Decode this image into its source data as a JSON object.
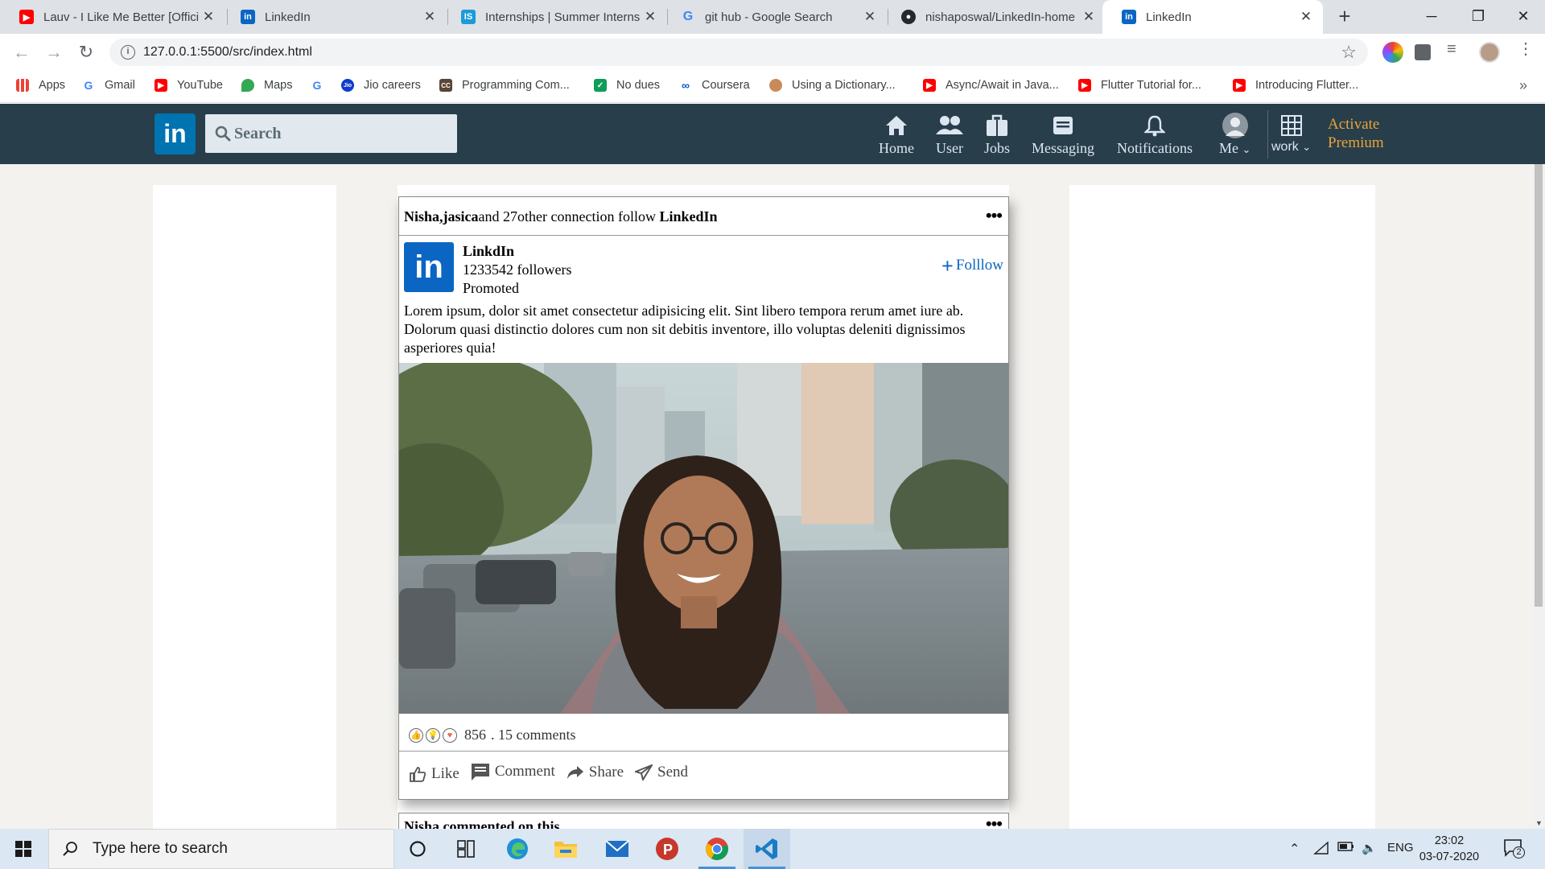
{
  "browser": {
    "tabs": [
      {
        "title": "Lauv - I Like Me Better [Offici",
        "favicon": "youtube-icon",
        "active": false
      },
      {
        "title": "LinkedIn",
        "favicon": "linkedin-icon",
        "active": false
      },
      {
        "title": "Internships | Summer Interns",
        "favicon": "internshala-icon",
        "active": false
      },
      {
        "title": "git hub - Google Search",
        "favicon": "google-icon",
        "active": false
      },
      {
        "title": "nishaposwal/LinkedIn-home",
        "favicon": "github-icon",
        "active": false
      },
      {
        "title": "LinkedIn",
        "favicon": "linkedin-icon",
        "active": true
      }
    ],
    "url": "127.0.0.1:5500/src/index.html",
    "bookmarks": [
      {
        "label": "Apps",
        "icon": "apps-grid-icon"
      },
      {
        "label": "Gmail",
        "icon": "google-icon"
      },
      {
        "label": "YouTube",
        "icon": "youtube-icon"
      },
      {
        "label": "Maps",
        "icon": "maps-pin-icon"
      },
      {
        "label": "",
        "icon": "google-icon"
      },
      {
        "label": "Jio careers",
        "icon": "jio-icon"
      },
      {
        "label": "Programming Com...",
        "icon": "cc-icon"
      },
      {
        "label": "No dues",
        "icon": "sheet-icon"
      },
      {
        "label": "Coursera",
        "icon": "coursera-icon"
      },
      {
        "label": "Using a Dictionary...",
        "icon": "avatar-icon"
      },
      {
        "label": "Async/Await in Java...",
        "icon": "youtube-icon"
      },
      {
        "label": "Flutter Tutorial for...",
        "icon": "youtube-icon"
      },
      {
        "label": "Introducing Flutter...",
        "icon": "youtube-icon"
      }
    ]
  },
  "header": {
    "logo": "in",
    "search_placeholder": "Search",
    "nav": [
      {
        "label": "Home",
        "icon": "home-icon"
      },
      {
        "label": "User",
        "icon": "users-icon"
      },
      {
        "label": "Jobs",
        "icon": "briefcase-icon"
      },
      {
        "label": "Messaging",
        "icon": "messaging-icon"
      },
      {
        "label": "Notifications",
        "icon": "bell-icon"
      },
      {
        "label": "Me",
        "icon": "avatar-icon"
      }
    ],
    "work_label": "work",
    "premium_line1": "Activate",
    "premium_line2": "Premium"
  },
  "post": {
    "connection_names": "Nisha,jasica",
    "connection_text": "and 27other connection follow ",
    "connection_company": "LinkedIn",
    "logo": "in",
    "company": "LinkdIn",
    "followers": "1233542 followers",
    "promoted": "Promoted",
    "follow_label": "Folllow",
    "text": "Lorem ipsum, dolor sit amet consectetur adipisicing elit. Sint libero tempora rerum amet iure ab. Dolorum quasi distinctio dolores cum non sit debitis inventore, illo voluptas deleniti dignissimos asperiores quia!",
    "reactions_count": "856",
    "comments": ". 15 comments",
    "actions": {
      "like": "Like",
      "comment": "Comment",
      "share": "Share",
      "send": "Send"
    }
  },
  "next_post": {
    "text": "Nisha commented on this"
  },
  "taskbar": {
    "search_placeholder": "Type here to search",
    "language": "ENG",
    "time": "23:02",
    "date": "03-07-2020",
    "notification_count": "2"
  },
  "colors": {
    "linkedin_header": "#283e4a",
    "linkedin_blue": "#0a66c2",
    "premium_gold": "#e7a33e"
  }
}
